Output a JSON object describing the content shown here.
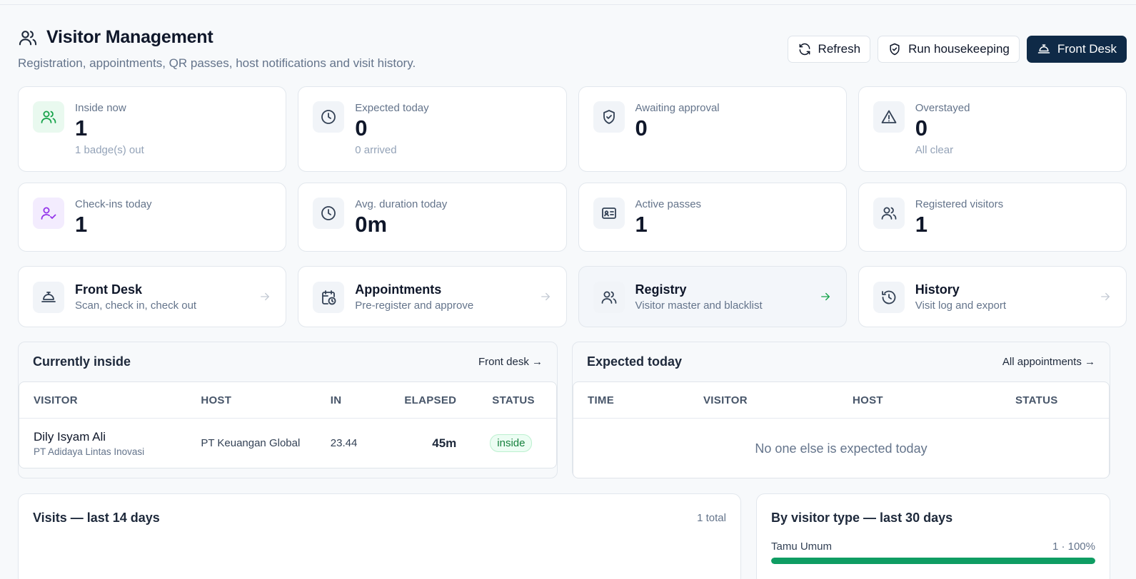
{
  "header": {
    "title": "Visitor Management",
    "subtitle": "Registration, appointments, QR passes, host notifications and visit history.",
    "actions": [
      {
        "label": "Refresh",
        "icon": "refresh-icon"
      },
      {
        "label": "Run housekeeping",
        "icon": "shield-check-icon"
      },
      {
        "label": "Front Desk",
        "icon": "concierge-bell-icon"
      }
    ]
  },
  "stats": [
    {
      "label": "Inside now",
      "value": "1",
      "sub": "1 badge(s) out",
      "icon": "users-icon",
      "accent": "#16a34a"
    },
    {
      "label": "Expected today",
      "value": "0",
      "sub": "0 arrived",
      "icon": "clock-icon"
    },
    {
      "label": "Awaiting approval",
      "value": "0",
      "sub": "",
      "icon": "shield-check-icon"
    },
    {
      "label": "Overstayed",
      "value": "0",
      "sub": "All clear",
      "icon": "warning-icon"
    },
    {
      "label": "Check-ins today",
      "value": "1",
      "icon": "user-check-icon",
      "accent": "#9333ea"
    },
    {
      "label": "Avg. duration today",
      "value": "0m",
      "icon": "clock-icon"
    },
    {
      "label": "Active passes",
      "value": "1",
      "icon": "id-card-icon"
    },
    {
      "label": "Registered visitors",
      "value": "1",
      "icon": "users-icon"
    }
  ],
  "nav": [
    {
      "title": "Front Desk",
      "sub": "Scan, check in, check out",
      "icon": "concierge-bell-icon"
    },
    {
      "title": "Appointments",
      "sub": "Pre-register and approve",
      "icon": "calendar-clock-icon"
    },
    {
      "title": "Registry",
      "sub": "Visitor master and blacklist",
      "icon": "users-icon",
      "active": true
    },
    {
      "title": "History",
      "sub": "Visit log and export",
      "icon": "history-icon"
    }
  ],
  "inside": {
    "title": "Currently inside",
    "link": "Front desk →",
    "columns": [
      "VISITOR",
      "HOST",
      "IN",
      "ELAPSED",
      "STATUS"
    ],
    "rows": [
      {
        "visitor": "Dily Isyam Ali",
        "company": "PT Adidaya Lintas Inovasi",
        "host": "PT Keuangan Global",
        "in": "23.44",
        "elapsed": "45m",
        "status": "inside"
      }
    ]
  },
  "expected": {
    "title": "Expected today",
    "link": "All appointments →",
    "columns": [
      "TIME",
      "VISITOR",
      "HOST",
      "STATUS"
    ],
    "empty": "No one else is expected today"
  },
  "visits": {
    "title": "Visits — last 14 days",
    "total": "1 total"
  },
  "by_type": {
    "title": "By visitor type — last 30 days",
    "items": [
      {
        "name": "Tamu Umum",
        "value_label": "1 · 100%",
        "share": 1.0
      }
    ],
    "bar_color": "#0f9d63"
  }
}
